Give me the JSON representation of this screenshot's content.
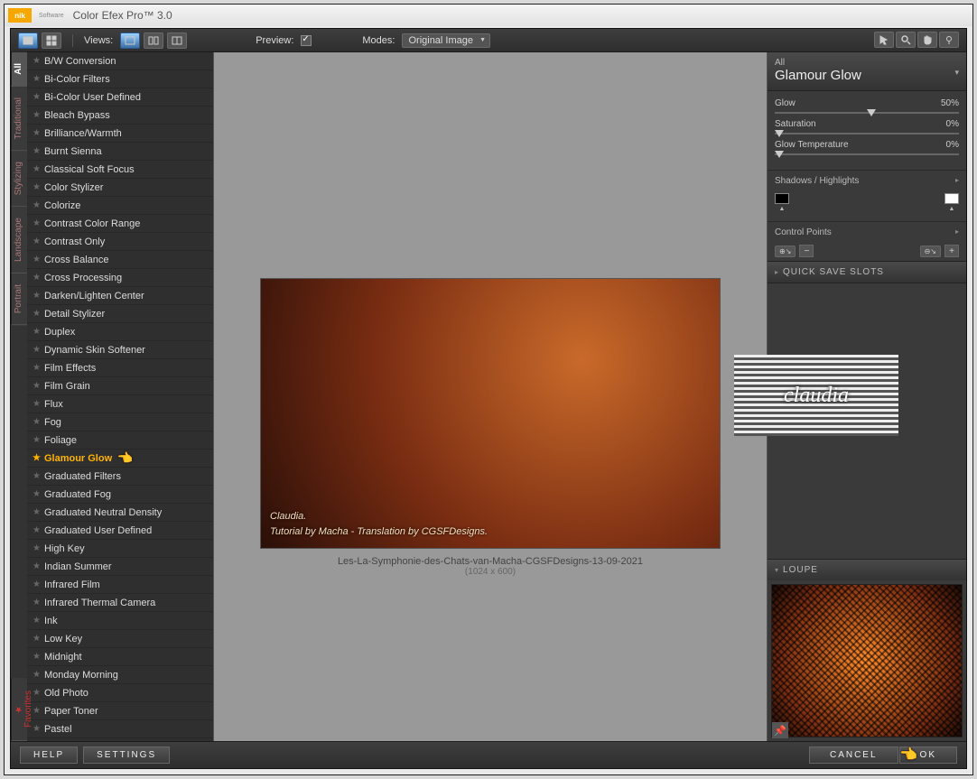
{
  "titlebar": {
    "logo": "nik",
    "suffix": "Software",
    "title": "Color Efex Pro™ 3.0"
  },
  "toolbar": {
    "views_label": "Views:",
    "preview_label": "Preview:",
    "modes_label": "Modes:",
    "modes_value": "Original Image"
  },
  "categories": {
    "items": [
      {
        "label": "All",
        "selected": true
      },
      {
        "label": "Traditional"
      },
      {
        "label": "Stylizing"
      },
      {
        "label": "Landscape"
      },
      {
        "label": "Portrait"
      }
    ],
    "favorites": "Favorites"
  },
  "filters": [
    "B/W Conversion",
    "Bi-Color Filters",
    "Bi-Color User Defined",
    "Bleach Bypass",
    "Brilliance/Warmth",
    "Burnt Sienna",
    "Classical Soft Focus",
    "Color Stylizer",
    "Colorize",
    "Contrast Color Range",
    "Contrast Only",
    "Cross Balance",
    "Cross Processing",
    "Darken/Lighten Center",
    "Detail Stylizer",
    "Duplex",
    "Dynamic Skin Softener",
    "Film Effects",
    "Film Grain",
    "Flux",
    "Fog",
    "Foliage",
    "Glamour Glow",
    "Graduated Filters",
    "Graduated Fog",
    "Graduated Neutral Density",
    "Graduated User Defined",
    "High Key",
    "Indian Summer",
    "Infrared Film",
    "Infrared Thermal Camera",
    "Ink",
    "Low Key",
    "Midnight",
    "Monday Morning",
    "Old Photo",
    "Paper Toner",
    "Pastel"
  ],
  "filters_selected_index": 22,
  "preview": {
    "overlay_line1": "Claudia.",
    "overlay_line2": "Tutorial by Macha - Translation by CGSFDesigns.",
    "caption": "Les-La-Symphonie-des-Chats-van-Macha-CGSFDesigns-13-09-2021",
    "dimensions": "(1024 x 600)"
  },
  "rightpanel": {
    "category": "All",
    "title": "Glamour Glow",
    "sliders": [
      {
        "label": "Glow",
        "value": "50%",
        "pos": "v50"
      },
      {
        "label": "Saturation",
        "value": "0%",
        "pos": "v0"
      },
      {
        "label": "Glow Temperature",
        "value": "0%",
        "pos": "v0"
      }
    ],
    "shadows_label": "Shadows / Highlights",
    "control_points_label": "Control Points",
    "quick_save": "QUICK SAVE SLOTS",
    "loupe": "LOUPE"
  },
  "footer": {
    "help": "HELP",
    "settings": "SETTINGS",
    "cancel": "CANCEL",
    "ok": "OK"
  },
  "watermark": "claudia"
}
